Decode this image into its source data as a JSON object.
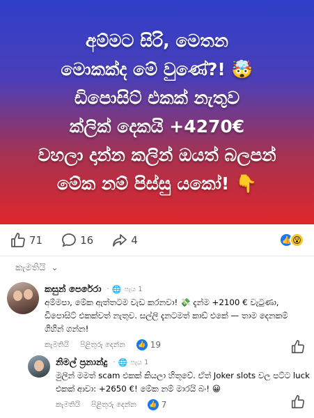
{
  "hero": {
    "lines": [
      "අම්මට සිරි, මෙතන",
      "මොකක්ද මේ වුණේ?! 🤯",
      "ඩිපොසිට් එකක් නැතුව",
      "ක්ලික් දෙකයි +4270€",
      "වහලා දාන්න කලින් ඔයත් බලපන්",
      "මේක නම් පිස්සු යකෝ! 👇"
    ]
  },
  "reactions": {
    "like_count": "71",
    "comment_count": "16",
    "share_count": "4",
    "icons": [
      "like-icon",
      "comment-icon",
      "share-icon",
      "like-emoji-icon",
      "wow-emoji-icon"
    ]
  },
  "sort": {
    "label": "කැමතියි"
  },
  "comments": [
    {
      "name": "කසුන් පෙරේරා",
      "time": "පැය 1",
      "text": "අම්මපා, මේක ඇත්තටම වැඩ කරනවා! 💸 දැන්ම +2100 € වැටුණා, ඩිපොසිට් එකක්වත් නැතුව. සල්ලි දැනටමත් කාඩ් එකේ — තාම දෙනකම් ගිහින් ගන්න!",
      "like_label": "කැමතියි",
      "reply_label": "පිළිතුරු දෙන්න",
      "likes": "19"
    },
    {
      "name": "නිමල් ප්‍රනාන්දු",
      "time": "පැය 1",
      "text": "මුලින් මමත් scam එකක් කියලා හිතුවේ. ඒත් Joker slots වල පට්ට luck එකක් ආවා: +2650 €! මේක නම් මාරයි බං! 😀",
      "like_label": "කැමතියි",
      "reply_label": "පිළිතුරු දෙන්න",
      "likes": "7"
    }
  ],
  "colors": {
    "accent": "#1877f2",
    "hero_top": "#2f3fc9",
    "hero_bottom": "#e0262b"
  }
}
